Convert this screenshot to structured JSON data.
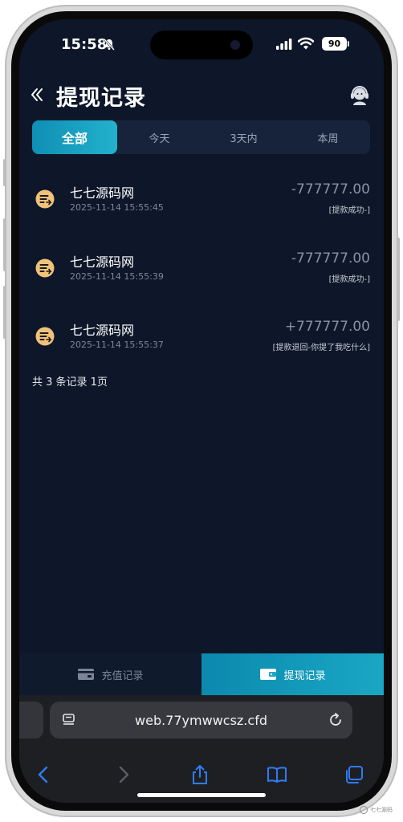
{
  "status_bar": {
    "time": "15:58",
    "battery": "90"
  },
  "header": {
    "title": "提现记录"
  },
  "tabs": [
    {
      "label": "全部",
      "active": true
    },
    {
      "label": "今天",
      "active": false
    },
    {
      "label": "3天内",
      "active": false
    },
    {
      "label": "本周",
      "active": false
    }
  ],
  "records": [
    {
      "name": "七七源码网",
      "time": "2025-11-14 15:55:45",
      "amount": "-777777.00",
      "status": "[提款成功-]"
    },
    {
      "name": "七七源码网",
      "time": "2025-11-14 15:55:39",
      "amount": "-777777.00",
      "status": "[提款成功-]"
    },
    {
      "name": "七七源码网",
      "time": "2025-11-14 15:55:37",
      "amount": "+777777.00",
      "status": "[提款退回-你提了我吃什么]"
    }
  ],
  "summary": "共 3 条记录 1页",
  "bottom_nav": {
    "recharge_label": "充值记录",
    "withdraw_label": "提现记录"
  },
  "browser": {
    "url": "web.77ymwwcsz.cfd"
  },
  "watermark": "七七源码",
  "colors": {
    "accent": "#1aa7c4",
    "background": "#0d1729",
    "icon": "#f0c27a"
  }
}
